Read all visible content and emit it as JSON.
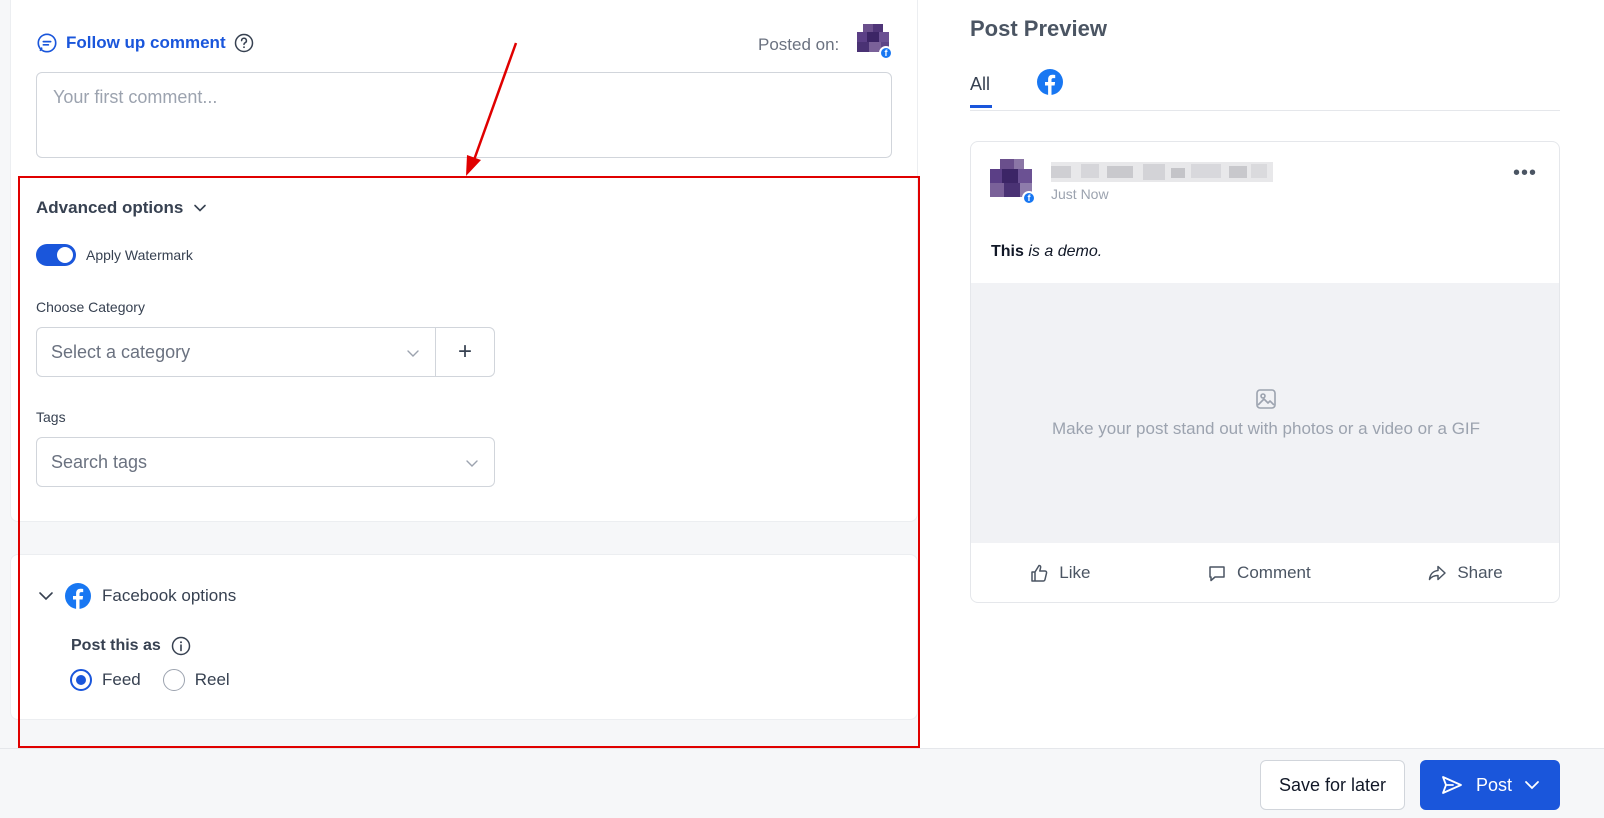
{
  "composer": {
    "follow_up_label": "Follow up comment",
    "posted_on_label": "Posted on:",
    "comment_placeholder": "Your first comment..."
  },
  "advanced": {
    "title": "Advanced options",
    "watermark_label": "Apply Watermark",
    "watermark_enabled": true,
    "category_label": "Choose Category",
    "category_placeholder": "Select a category",
    "add_category_symbol": "+",
    "tags_label": "Tags",
    "tags_placeholder": "Search tags"
  },
  "facebook_options": {
    "title": "Facebook options",
    "post_as_label": "Post this as",
    "options": [
      "Feed",
      "Reel"
    ],
    "selected": "Feed"
  },
  "preview": {
    "title": "Post Preview",
    "tab_all": "All",
    "tab_facebook_icon": "facebook-icon",
    "time": "Just Now",
    "text_bold": "This",
    "text_italic": "is a demo.",
    "media_hint": "Make your post stand out with photos or a video or a GIF",
    "actions": [
      "Like",
      "Comment",
      "Share"
    ]
  },
  "footer": {
    "save_label": "Save for later",
    "post_label": "Post"
  },
  "colors": {
    "accent": "#1a56db",
    "facebook": "#1877f2",
    "annotation": "#e00000"
  }
}
